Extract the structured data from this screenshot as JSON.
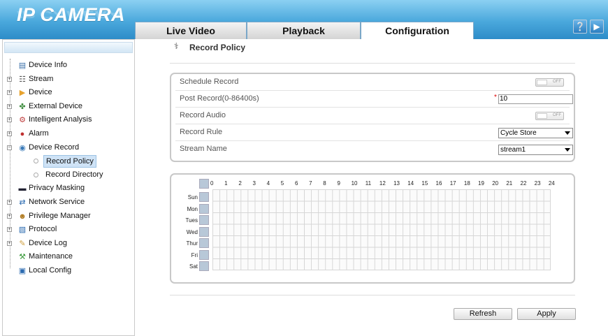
{
  "app": {
    "logo": "IP CAMERA"
  },
  "tabs": [
    {
      "label": "Live Video"
    },
    {
      "label": "Playback"
    },
    {
      "label": "Configuration"
    }
  ],
  "sidebar": {
    "items": [
      {
        "label": "Device Info"
      },
      {
        "label": "Stream"
      },
      {
        "label": "Device"
      },
      {
        "label": "External Device"
      },
      {
        "label": "Intelligent Analysis"
      },
      {
        "label": "Alarm"
      },
      {
        "label": "Device Record"
      },
      {
        "label": "Record Policy"
      },
      {
        "label": "Record Directory"
      },
      {
        "label": "Privacy Masking"
      },
      {
        "label": "Network Service"
      },
      {
        "label": "Privilege Manager"
      },
      {
        "label": "Protocol"
      },
      {
        "label": "Device Log"
      },
      {
        "label": "Maintenance"
      },
      {
        "label": "Local Config"
      }
    ]
  },
  "page": {
    "title": "Record Policy"
  },
  "form": {
    "schedule_record": {
      "label": "Schedule Record",
      "state": "OFF"
    },
    "post_record": {
      "label": "Post Record(0-86400s)",
      "value": "10",
      "required_mark": "*"
    },
    "record_audio": {
      "label": "Record Audio",
      "state": "OFF"
    },
    "record_rule": {
      "label": "Record Rule",
      "value": "Cycle Store"
    },
    "stream_name": {
      "label": "Stream Name",
      "value": "stream1"
    }
  },
  "schedule": {
    "hours": [
      "0",
      "1",
      "2",
      "3",
      "4",
      "5",
      "6",
      "7",
      "8",
      "9",
      "10",
      "11",
      "12",
      "13",
      "14",
      "15",
      "16",
      "17",
      "18",
      "19",
      "20",
      "21",
      "22",
      "23",
      "24"
    ],
    "days": [
      "Sun",
      "Mon",
      "Tues",
      "Wed",
      "Thur",
      "Fri",
      "Sat"
    ]
  },
  "buttons": {
    "refresh": "Refresh",
    "apply": "Apply"
  }
}
